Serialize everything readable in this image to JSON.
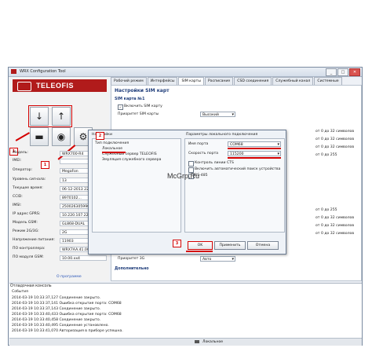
{
  "window": {
    "title": "WRX Configuration Tool",
    "buttons": [
      "_",
      "□",
      "✕"
    ]
  },
  "logo": "TELEOFIS",
  "left": {
    "buttons": [
      "↓",
      "↑",
      "▬",
      "◉",
      "⚙"
    ],
    "info": [
      {
        "label": "Модель:",
        "value": "WRX700-R4"
      },
      {
        "label": "IMEI:",
        "value": ""
      },
      {
        "label": "Оператор:",
        "value": "MegaFon"
      },
      {
        "label": "Уровень сигнала:",
        "value": "13"
      },
      {
        "label": "Текущее время:",
        "value": "06-12-2013 22:39:36"
      },
      {
        "label": "CCID:",
        "value": "8970102..."
      },
      {
        "label": "IMSI:",
        "value": "250026305990471"
      },
      {
        "label": "IP адрес GPRS:",
        "value": "10.220.107.220"
      },
      {
        "label": "Модель GSM:",
        "value": "GL868-DUAL"
      },
      {
        "label": "Режим 2G/3G:",
        "value": "2G"
      },
      {
        "label": "Напряжение питания:",
        "value": "11903"
      },
      {
        "label": "ПО контроллера:",
        "value": "WRX7AA.41.00.000"
      },
      {
        "label": "ПО модуля GSM:",
        "value": "10.00.xx4"
      }
    ],
    "about_link": "О программе"
  },
  "tabs": [
    "Рабочий режим",
    "Интерфейсы",
    "SIM карты",
    "Расписание",
    "CSD соединения",
    "Служебный канал",
    "Системные"
  ],
  "right": {
    "title": "Настройки SIM карт",
    "section1": "SIM карта №1",
    "enable_sim": "Включить SIM карту",
    "priority_label": "Приоритет SIM карты",
    "priority_value": "Высокий",
    "side_values": [
      "от 0 до 32 символов",
      "от 0 до 32 символов",
      "от 0 до 32 символов",
      "от 0 до 255",
      "от 0 до 255",
      "от 0 до 32 символов",
      "от 0 до 32 символов",
      "от 0 до 32 символов"
    ],
    "priority3g_label": "Приоритет 3G",
    "priority3g_value": "Авто",
    "extra_section": "Дополнительно"
  },
  "dialog": {
    "settings_label": "Настройки",
    "tree": [
      "Тип подключения",
      "Локальное",
      "Служебный сервер TELEOFIS",
      "Эмуляция служебного сервера"
    ],
    "params_label": "Параметры локального подключения",
    "port_label": "Имя порта",
    "port_value": "COM68",
    "speed_label": "Скорость порта",
    "speed_value": "115200",
    "cts_label": "Контроль линии CTS",
    "auto_label": "Включить автоматический поиск устройства",
    "rs485_label": "RS-485",
    "ok": "OK",
    "apply": "Применить",
    "cancel": "Отмена"
  },
  "markers": [
    "1",
    "1",
    "2",
    "3"
  ],
  "watermark": "McGrp.Ru",
  "console": {
    "title": "Отладочная консоль",
    "events_label": "События",
    "log": [
      "2014-03-19 10:33:37,127 Соединение закрыто.",
      "2014-03-19 10:33:37,141 Ошибка открытия порта: COM68",
      "2014-03-19 10:33:37,143 Соединение закрыто.",
      "2014-03-19 10:33:40,433 Ошибка открытия порта: COM68",
      "2014-03-19 10:33:40,458 Соединение закрыто.",
      "2014-03-19 10:33:40,495 Соединение установлено.",
      "2014-03-19 10:33:41,070 Авторизация в приборе успешна."
    ]
  },
  "status": "Локальное",
  "colors": {
    "accent": "#1f3d7a",
    "brand": "#b11b1b",
    "highlight": "#d40000"
  }
}
